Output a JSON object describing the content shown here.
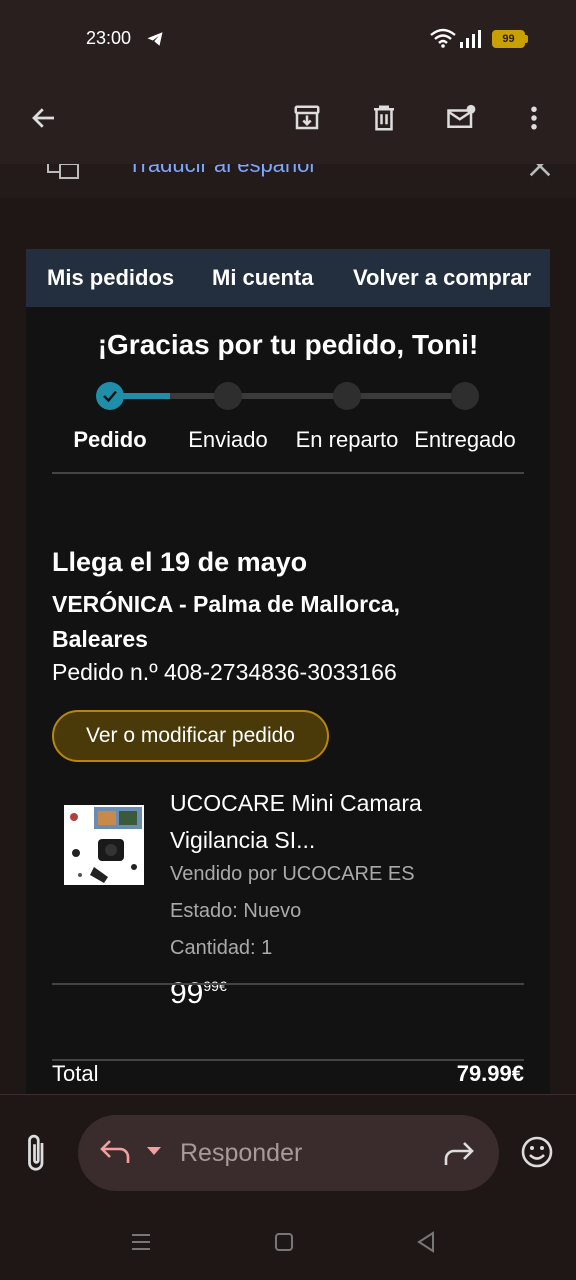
{
  "status_bar": {
    "time": "23:00",
    "battery": "99"
  },
  "translate_bar": {
    "text": "Traducir al español"
  },
  "email": {
    "nav": {
      "my_orders": "Mis pedidos",
      "my_account": "Mi cuenta",
      "buy_again": "Volver a comprar"
    },
    "thanks": "¡Gracias por tu pedido, Toni!",
    "progress": {
      "steps": [
        "Pedido",
        "Enviado",
        "En reparto",
        "Entregado"
      ],
      "current_step": 1
    },
    "arrival": "Llega el 19 de mayo",
    "address": "VERÓNICA - Palma de Mallorca, Baleares",
    "order_number": "Pedido n.º 408-2734836-3033166",
    "modify_button": "Ver o modificar pedido",
    "product": {
      "title": "UCOCARE Mini Camara Vigilancia SI...",
      "seller": "Vendido por UCOCARE ES",
      "state": "Estado: Nuevo",
      "quantity": "Cantidad: 1",
      "price_int": "99",
      "price_dec": "99€"
    },
    "total_label": "Total",
    "total_value": "79.99€"
  },
  "reply_bar": {
    "placeholder": "Responder"
  },
  "colors": {
    "accent": "#1f8ea8",
    "nav_bg": "#232f3e",
    "button_bg": "#4a3a0a",
    "button_border": "#b8860b"
  }
}
